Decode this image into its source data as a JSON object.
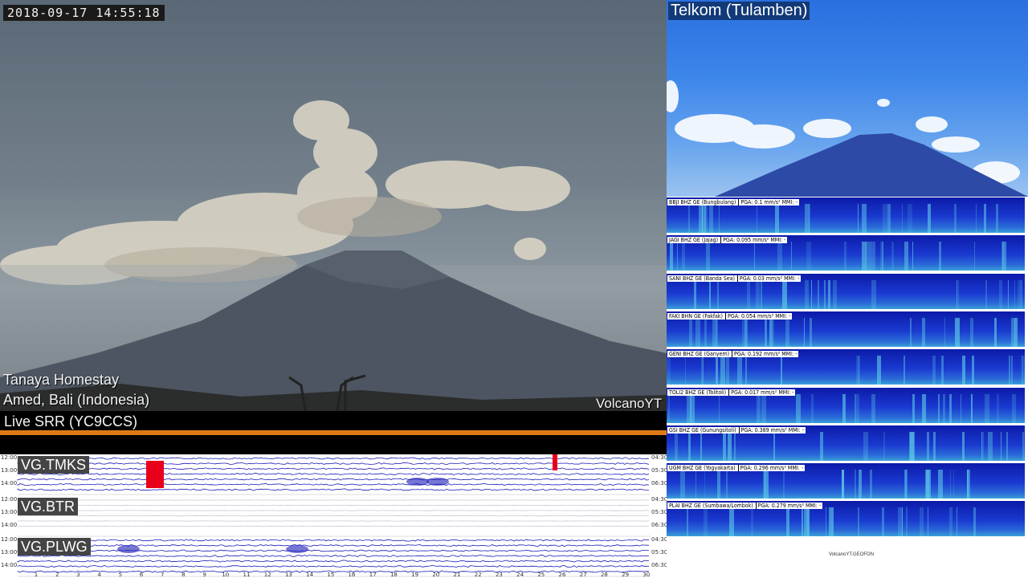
{
  "main_camera": {
    "timestamp": "2018-09-17  14:55:18",
    "location_line1": "Tanaya Homestay",
    "location_line2": "Amed, Bali (Indonesia)",
    "credit": "VolcanoYT"
  },
  "live_label": "Live SRR (YC9CCS)",
  "helicorder": {
    "stations": [
      {
        "label": "VG.TMKS",
        "left_times": [
          "12:00",
          "13:00",
          "14:00"
        ],
        "right_times": [
          "04:30",
          "05:30",
          "06:30"
        ]
      },
      {
        "label": "VG.BTR",
        "left_times": [
          "12:00",
          "13:00",
          "14:00"
        ],
        "right_times": [
          "04:30",
          "05:30",
          "06:30"
        ]
      },
      {
        "label": "VG.PLWG",
        "left_times": [
          "12:00",
          "13:00",
          "14:00"
        ],
        "right_times": [
          "04:30",
          "05:30",
          "06:30"
        ]
      }
    ],
    "x_ticks": [
      "1",
      "2",
      "3",
      "4",
      "5",
      "6",
      "7",
      "8",
      "9",
      "10",
      "11",
      "12",
      "13",
      "14",
      "15",
      "16",
      "17",
      "18",
      "19",
      "20",
      "21",
      "22",
      "23",
      "24",
      "25",
      "26",
      "27",
      "28",
      "29",
      "30"
    ],
    "trace_color": "#1a1ab8",
    "event_color": "#e8001a"
  },
  "secondary_camera": {
    "title": "Telkom (Tulamben)"
  },
  "spectrograms": [
    {
      "label": "BBJI BHZ GE (Bungbulang)",
      "pga": "PGA: 0.1 mm/s² MMI: -"
    },
    {
      "label": "JAGI BHZ GE (Jajag)",
      "pga": "PGA: 0.095 mm/s² MMI: -"
    },
    {
      "label": "SANI BHZ GE (Banda Sea)",
      "pga": "PGA: 0.03 mm/s² MMI: -"
    },
    {
      "label": "FAKI BHN GE (Fakfak)",
      "pga": "PGA: 0.054 mm/s² MMI: -"
    },
    {
      "label": "GENI BHZ GE (Ganyem)",
      "pga": "PGA: 0.192 mm/s² MMI: -"
    },
    {
      "label": "TOLI2 BHZ GE (Tolitoli)",
      "pga": "PGA: 0.017 mm/s² MMI: -"
    },
    {
      "label": "GSI BHZ GE (Gunungsitoli)",
      "pga": "PGA: 0.389 mm/s² MMI: -"
    },
    {
      "label": "UGM BHZ GE (Yogyakarta)",
      "pga": "PGA: 0.296 mm/s² MMI: -"
    },
    {
      "label": "PLAI BHZ GE (Sumbawa/Lombok)",
      "pga": "PGA: 0.279 mm/s² MMI: -"
    }
  ],
  "watermark": "VolcanoYT.GEOFON"
}
